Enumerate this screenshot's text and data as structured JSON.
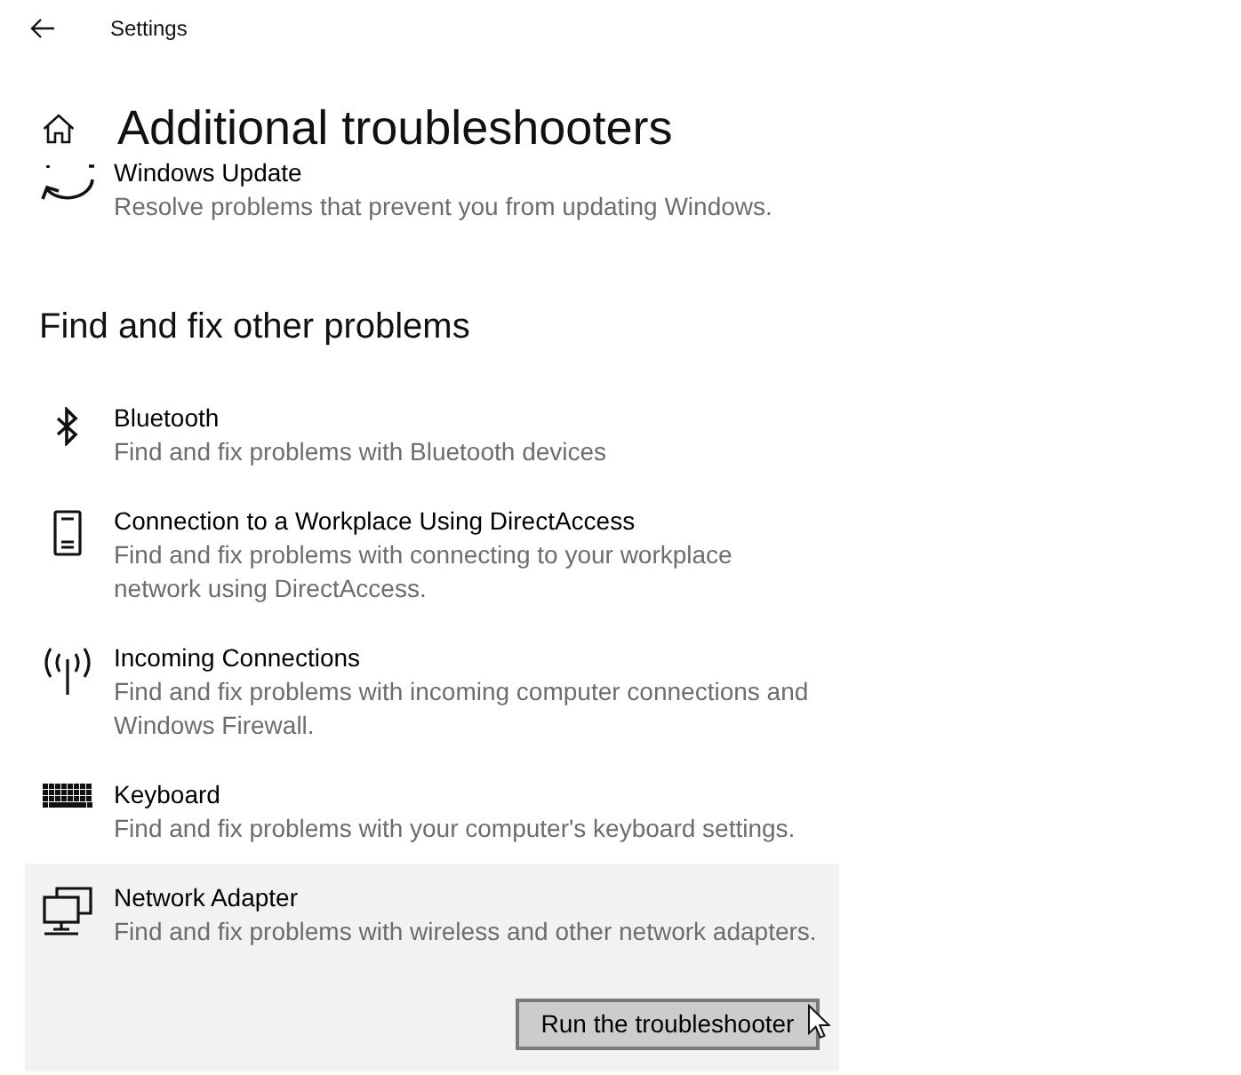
{
  "window": {
    "title": "Settings"
  },
  "page": {
    "title": "Additional troubleshooters"
  },
  "top_items": [
    {
      "kind": "update",
      "title": "Windows Update",
      "description": "Resolve problems that prevent you from updating Windows."
    }
  ],
  "section": {
    "title": "Find and fix other problems"
  },
  "items": [
    {
      "kind": "bluetooth",
      "title": "Bluetooth",
      "description": "Find and fix problems with Bluetooth devices",
      "selected": false
    },
    {
      "kind": "phone",
      "title": "Connection to a Workplace Using DirectAccess",
      "description": "Find and fix problems with connecting to your workplace network using DirectAccess.",
      "selected": false
    },
    {
      "kind": "antenna",
      "title": "Incoming Connections",
      "description": "Find and fix problems with incoming computer connections and Windows Firewall.",
      "selected": false
    },
    {
      "kind": "keyboard",
      "title": "Keyboard",
      "description": "Find and fix problems with your computer's keyboard settings.",
      "selected": false
    },
    {
      "kind": "network",
      "title": "Network Adapter",
      "description": "Find and fix problems with wireless and other network adapters.",
      "selected": true,
      "button": {
        "label": "Run the troubleshooter",
        "hovered": true
      }
    }
  ]
}
